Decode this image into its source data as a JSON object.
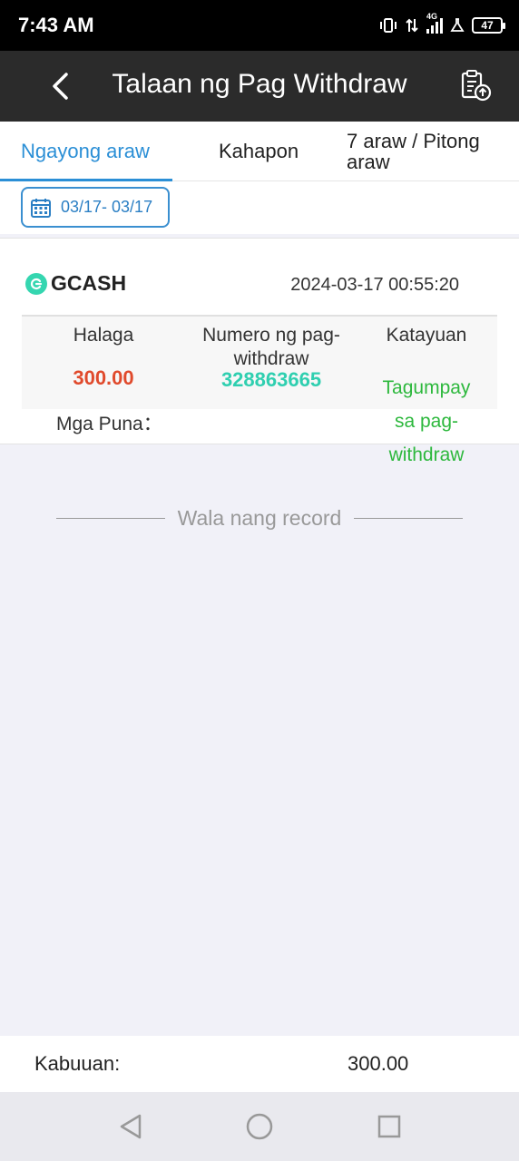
{
  "status_bar": {
    "time": "7:43 AM",
    "network": "4G",
    "battery": "47"
  },
  "header": {
    "title": "Talaan ng Pag Withdraw",
    "back_icon": "chevron-left-icon",
    "action_icon": "clipboard-upload-icon"
  },
  "tabs": [
    {
      "label": "Ngayong araw",
      "active": true
    },
    {
      "label": "Kahapon",
      "active": false
    },
    {
      "label": "7 araw / Pitong araw",
      "active": false
    }
  ],
  "date_filter": {
    "icon": "calendar-icon",
    "range": "03/17- 03/17"
  },
  "records": [
    {
      "method": "GCASH",
      "datetime": "2024-03-17 00:55:20",
      "amount_label": "Halaga",
      "amount": "300.00",
      "number_label": "Numero ng pag-withdraw",
      "number": "328863665",
      "status_label": "Katayuan",
      "status": "Tagumpay sa pag-withdraw",
      "remarks_label": "Mga Puna："
    }
  ],
  "no_more_records": "Wala nang record",
  "total": {
    "label": "Kabuuan:",
    "value": "300.00"
  },
  "colors": {
    "accent": "#2b8fd6",
    "amount": "#e04a2c",
    "number": "#2fcfb0",
    "success": "#2db83d",
    "header_bg": "#2b2b2b"
  },
  "nav": [
    "back-triangle-icon",
    "home-circle-icon",
    "recents-square-icon"
  ]
}
